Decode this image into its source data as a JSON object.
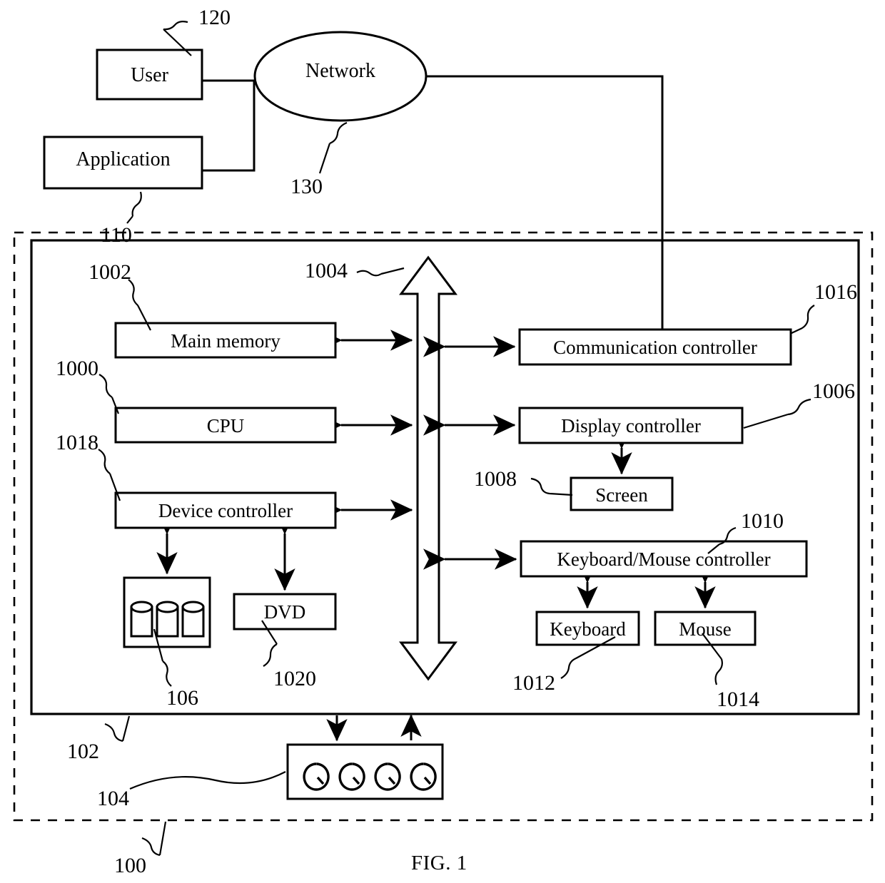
{
  "figure": {
    "caption": "FIG. 1",
    "type": "patent-block-diagram"
  },
  "blocks": {
    "user": "User",
    "application": "Application",
    "network": "Network",
    "main_memory": "Main memory",
    "cpu": "CPU",
    "device_controller": "Device controller",
    "dvd": "DVD",
    "communication_controller": "Communication controller",
    "display_controller": "Display controller",
    "screen": "Screen",
    "keyboard_mouse_controller": "Keyboard/Mouse controller",
    "keyboard": "Keyboard",
    "mouse": "Mouse",
    "storage": "",
    "peripheral": ""
  },
  "reference_numerals": {
    "system": "100",
    "computer": "102",
    "peripheral_device": "104",
    "storage": "106",
    "application": "110",
    "user": "120",
    "network": "130",
    "computer_body": "1000",
    "main_memory": "1002",
    "bus": "1004",
    "display_controller": "1006",
    "screen": "1008",
    "keyboard_mouse_controller": "1010",
    "keyboard": "1012",
    "mouse": "1014",
    "communication_controller": "1016",
    "device_controller": "1018",
    "dvd": "1020"
  },
  "icons": {
    "storage_disks": "disk-stack-icon",
    "peripheral_nozzles": "nozzle-glyph-icon",
    "bus_arrow": "double-headed-bus-arrow-icon"
  },
  "colors": {
    "stroke": "#000000",
    "background": "#ffffff"
  }
}
